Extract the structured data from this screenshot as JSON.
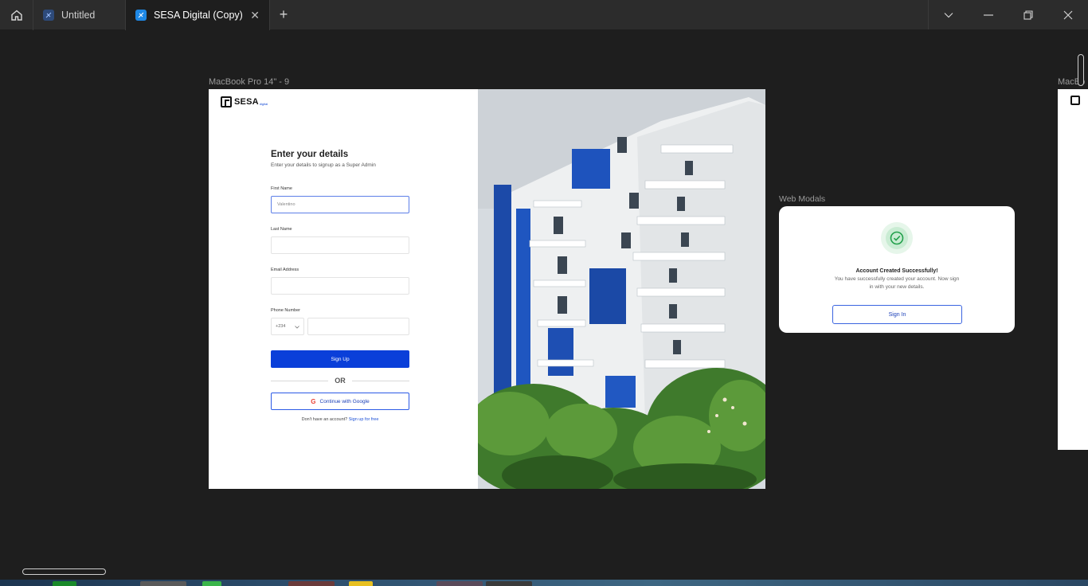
{
  "window": {
    "tabs": [
      {
        "label": "Untitled",
        "active": false
      },
      {
        "label": "SESA Digital (Copy)",
        "active": true
      }
    ],
    "new_tab": "+",
    "close_glyph": "✕"
  },
  "canvas": {
    "frame1_label": "MacBook Pro 14\" - 9",
    "frame2_label": "Web Modals",
    "frame3_label": "MacBo"
  },
  "signup": {
    "logo_text": "SESA",
    "logo_sub": "digital",
    "heading": "Enter your details",
    "subheading": "Enter your details to signup as a Super Admin",
    "first_name_label": "First Name",
    "first_name_value": "Valentino",
    "last_name_label": "Last Name",
    "email_label": "Email Address",
    "phone_label": "Phone Number",
    "country_code": "+234",
    "signup_button": "Sign Up",
    "or_text": "OR",
    "google_button": "Continue with Google",
    "footer_text": "Don't have an account?",
    "footer_link": "Sign up for free"
  },
  "modal": {
    "title": "Account Created Successfully!",
    "message": "You have successfully created your account. Now sign in with your new details.",
    "button": "Sign In"
  },
  "colors": {
    "primary": "#0a3fd9",
    "success": "#22a04b",
    "canvas_bg": "#1e1e1e"
  }
}
